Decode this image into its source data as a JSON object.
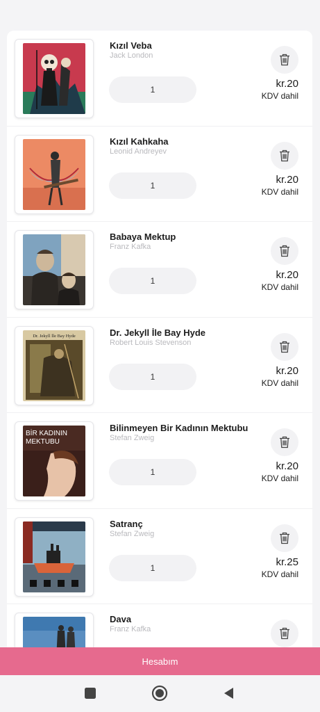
{
  "cart": {
    "items": [
      {
        "title": "Kızıl Veba",
        "author": "Jack London",
        "quantity": "1",
        "price": "kr.20",
        "vat_note": "KDV dahil"
      },
      {
        "title": "Kızıl Kahkaha",
        "author": "Leonid Andreyev",
        "quantity": "1",
        "price": "kr.20",
        "vat_note": "KDV dahil"
      },
      {
        "title": "Babaya Mektup",
        "author": "Franz Kafka",
        "quantity": "1",
        "price": "kr.20",
        "vat_note": "KDV dahil"
      },
      {
        "title": "Dr. Jekyll İle Bay Hyde",
        "author": "Robert Louis Stevenson",
        "quantity": "1",
        "price": "kr.20",
        "vat_note": "KDV dahil"
      },
      {
        "title": "Bilinmeyen Bir Kadının Mektubu",
        "author": "Stefan Zweig",
        "quantity": "1",
        "price": "kr.20",
        "vat_note": "KDV dahil"
      },
      {
        "title": "Satranç",
        "author": "Stefan Zweig",
        "quantity": "1",
        "price": "kr.25",
        "vat_note": "KDV dahil"
      },
      {
        "title": "Dava",
        "author": "Franz Kafka",
        "quantity": "",
        "price": "",
        "vat_note": ""
      }
    ]
  },
  "covers": {
    "jekyll_text": "Dr. Jekyll İle Bay Hyde",
    "kadin_line1": "BİR KADININ",
    "kadin_line2": "MEKTUBU"
  },
  "account_bar": {
    "label": "Hesabım"
  },
  "icons": {
    "delete": "trash-icon",
    "nav_recents": "square-icon",
    "nav_home": "circle-icon",
    "nav_back": "triangle-back-icon"
  },
  "colors": {
    "accent": "#e66a8e",
    "background": "#f4f4f6",
    "card": "#ffffff",
    "muted_text": "#b9b9bd"
  }
}
